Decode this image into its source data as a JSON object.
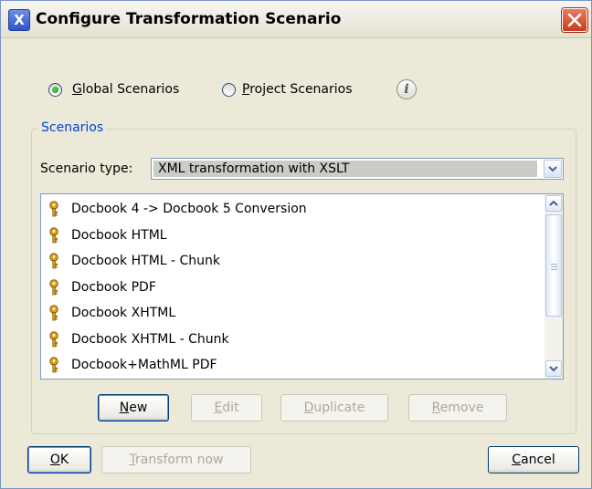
{
  "window": {
    "title": "Configure Transformation Scenario"
  },
  "scope": {
    "global_label": "Global Scenarios",
    "project_label": "Project Scenarios",
    "selected": "global"
  },
  "scenarios": {
    "group_title": "Scenarios",
    "type_label": "Scenario type:",
    "type_value": "XML transformation with XSLT",
    "items": [
      {
        "label": "Docbook 4 -> Docbook 5 Conversion"
      },
      {
        "label": "Docbook HTML"
      },
      {
        "label": "Docbook HTML - Chunk"
      },
      {
        "label": "Docbook PDF"
      },
      {
        "label": "Docbook XHTML"
      },
      {
        "label": "Docbook XHTML - Chunk"
      },
      {
        "label": "Docbook+MathML PDF"
      }
    ]
  },
  "buttons": {
    "new": {
      "mnemonic": "N",
      "rest": "ew"
    },
    "edit": {
      "mnemonic": "E",
      "rest": "dit"
    },
    "duplicate": {
      "mnemonic": "D",
      "rest": "uplicate"
    },
    "remove": {
      "mnemonic": "R",
      "rest": "emove"
    },
    "ok": {
      "mnemonic": "O",
      "rest": "K"
    },
    "transform": {
      "mnemonic": "T",
      "rest": "ransform now"
    },
    "cancel": {
      "mnemonic": "C",
      "rest": "ancel"
    }
  },
  "colors": {
    "accent": "#0046d5",
    "close_button": "#d04b2c",
    "radio_dot": "#22a822",
    "key_icon": "#d8a21c"
  }
}
